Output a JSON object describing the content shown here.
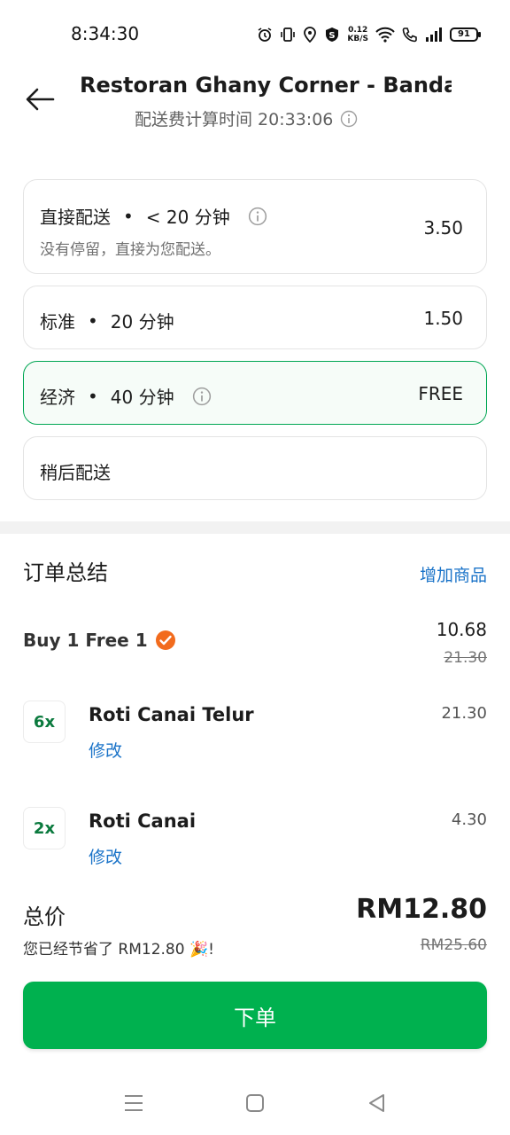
{
  "status_bar": {
    "time": "8:34:30",
    "net_speed_value": "0.12",
    "net_speed_unit": "KB/S",
    "battery": "91"
  },
  "header": {
    "restaurant_name": "Restoran Ghany Corner - Banda...",
    "fee_time_label": "配送费计算时间 20:33:06"
  },
  "delivery_options": [
    {
      "name": "直接配送",
      "eta": "< 20 分钟",
      "subtitle": "没有停留，直接为您配送。",
      "price": "3.50",
      "selected": false
    },
    {
      "name": "标准",
      "eta": "20 分钟",
      "price": "1.50",
      "selected": false
    },
    {
      "name": "经济",
      "eta": "40 分钟",
      "price": "FREE",
      "selected": true
    },
    {
      "name": "稍后配送"
    }
  ],
  "dot": "•",
  "summary": {
    "title": "订单总结",
    "add_items_label": "增加商品",
    "promo": {
      "label": "Buy 1 Free 1",
      "price": "10.68",
      "original_price": "21.30"
    },
    "items": [
      {
        "qty": "6x",
        "name": "Roti Canai Telur",
        "edit_label": "修改",
        "price": "21.30"
      },
      {
        "qty": "2x",
        "name": "Roti Canai",
        "edit_label": "修改",
        "price": "4.30"
      }
    ]
  },
  "total": {
    "label": "总价",
    "amount": "RM12.80",
    "savings": "您已经节省了 RM12.80 🎉!",
    "original": "RM25.60"
  },
  "place_order_label": "下单",
  "colors": {
    "brand_green": "#00b14f",
    "link_blue": "#1a73c8",
    "selected_border": "#00a653"
  },
  "icons": [
    "back-arrow-icon",
    "info-icon",
    "verified-badge-icon",
    "menu-icon",
    "home-icon",
    "back-triangle-icon"
  ]
}
